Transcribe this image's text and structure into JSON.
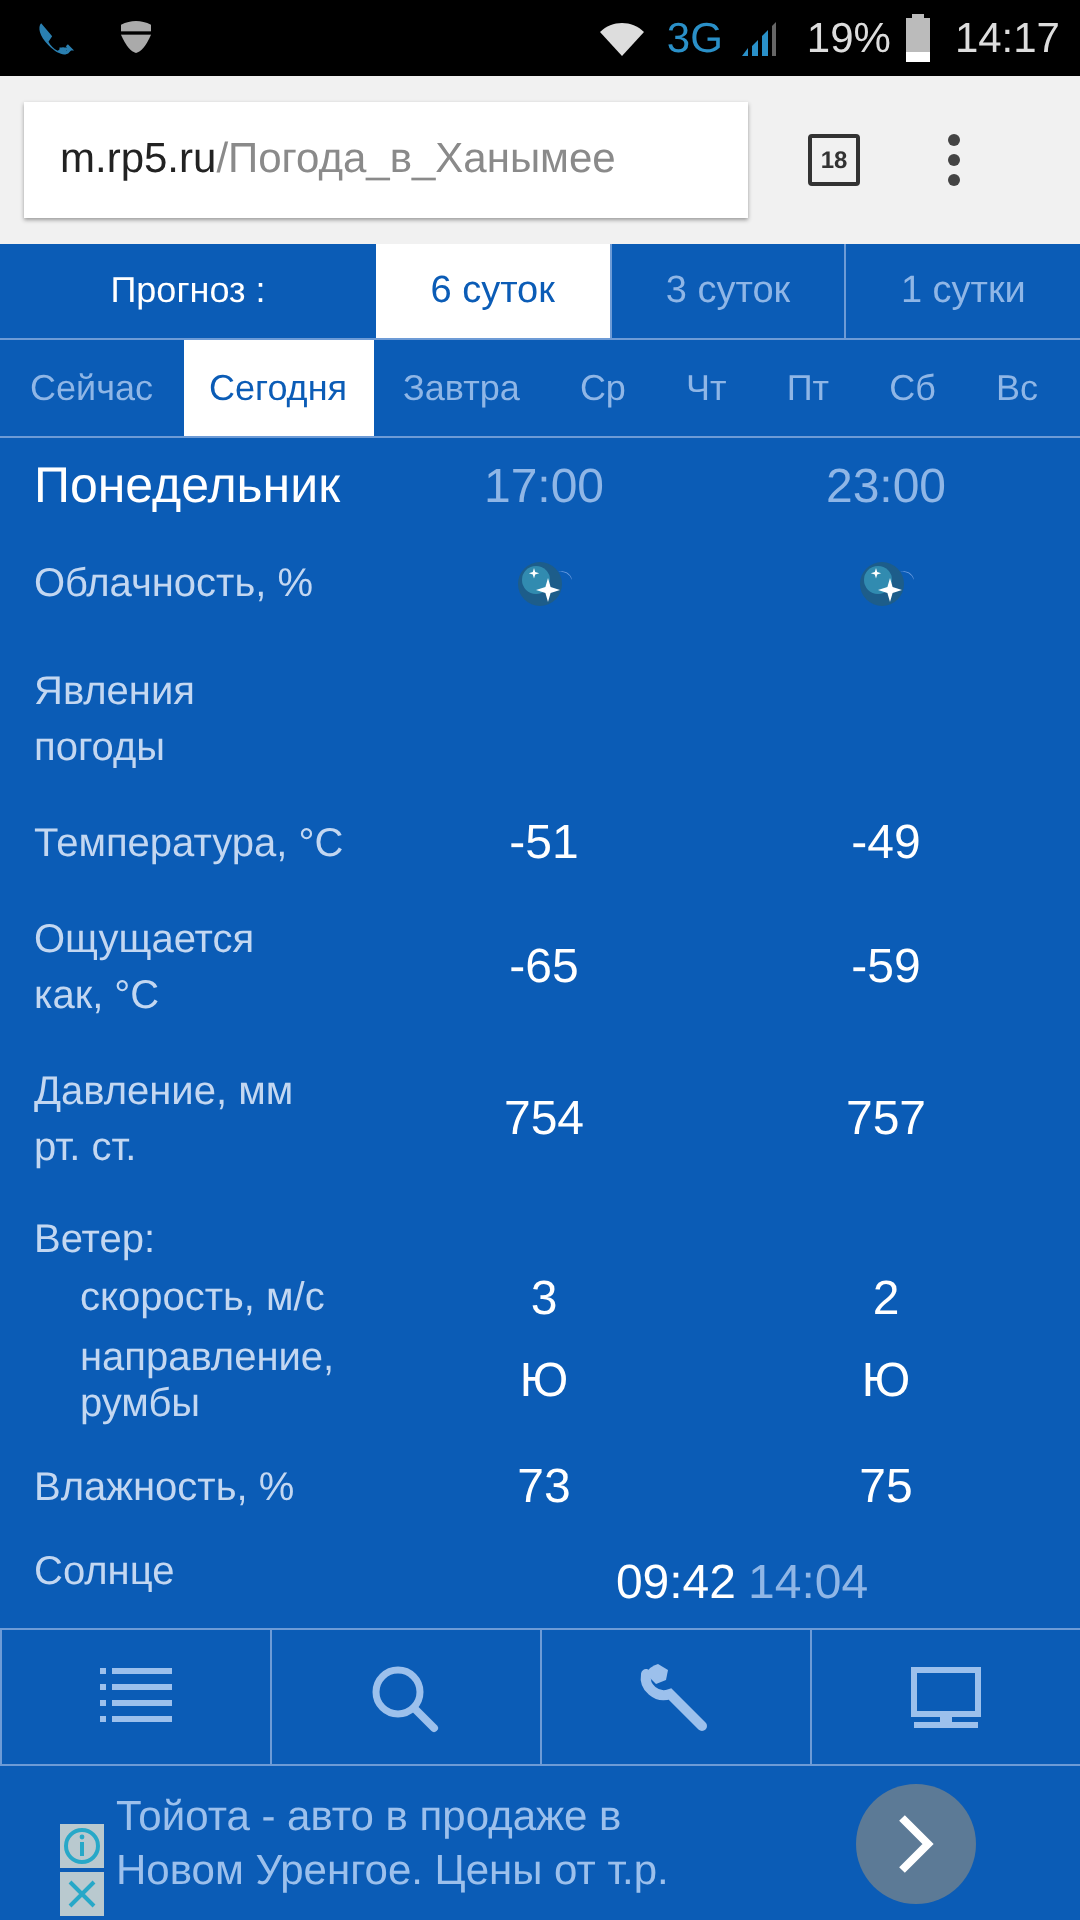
{
  "status_bar": {
    "network": "3G",
    "battery": "19%",
    "time": "14:17"
  },
  "browser": {
    "url_host": "m.rp5.ru",
    "url_path": "/Погода_в_Ханымее",
    "tab_count": "18"
  },
  "forecast": {
    "label": "Прогноз :",
    "tabs": [
      {
        "label": "6 суток",
        "selected": true
      },
      {
        "label": "3 суток",
        "selected": false
      },
      {
        "label": "1 сутки",
        "selected": false
      }
    ]
  },
  "days": [
    {
      "label": "Сейчас",
      "selected": false
    },
    {
      "label": "Сегодня",
      "selected": true
    },
    {
      "label": "Завтра",
      "selected": false
    },
    {
      "label": "Ср",
      "selected": false
    },
    {
      "label": "Чт",
      "selected": false
    },
    {
      "label": "Пт",
      "selected": false
    },
    {
      "label": "Сб",
      "selected": false
    },
    {
      "label": "Вс",
      "selected": false
    }
  ],
  "table": {
    "day": "Понедельник",
    "columns": [
      "17:00",
      "23:00"
    ],
    "rows": [
      {
        "kind": "icons",
        "label": "Облачность, %"
      },
      {
        "kind": "empty",
        "label": "Явления\nпогоды"
      },
      {
        "kind": "values",
        "label": "Температура, °C",
        "values": [
          "-51",
          "-49"
        ]
      },
      {
        "kind": "values",
        "label": "Ощущается\nкак, °C",
        "values": [
          "-65",
          "-59"
        ]
      },
      {
        "kind": "values",
        "label": "Давление, мм\nрт. ст.",
        "values": [
          "754",
          "757"
        ]
      },
      {
        "kind": "heading",
        "label": "Ветер:"
      },
      {
        "kind": "sub",
        "label": "скорость, м/с",
        "values": [
          "3",
          "2"
        ]
      },
      {
        "kind": "sub",
        "label": "направление,\nрумбы",
        "values": [
          "Ю",
          "Ю"
        ]
      },
      {
        "kind": "values",
        "label": "Влажность, %",
        "values": [
          "73",
          "75"
        ]
      },
      {
        "kind": "sun",
        "label": "Солнце",
        "values": [
          "09:42",
          "14:04"
        ]
      }
    ]
  },
  "ad": {
    "text": "Тойота - авто в продаже в\nНовом Уренгое. Цены от т.р."
  }
}
